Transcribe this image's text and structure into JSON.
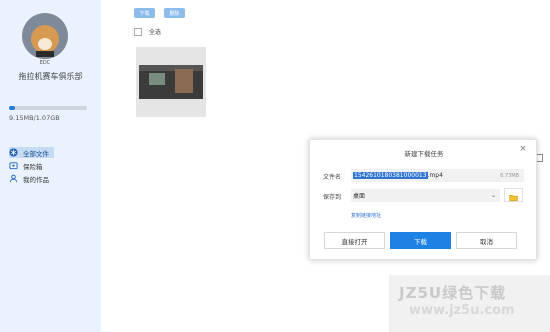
{
  "sidebar": {
    "avatar_tag": "EDC",
    "username": "拖拉机赛车俱乐部",
    "storage": {
      "text": "9.15MB/1.07GB",
      "fraction": 0.0083
    },
    "nav": [
      {
        "label": "全部文件",
        "icon": "snowflake-icon",
        "active": true
      },
      {
        "label": "保险箱",
        "icon": "safe-icon",
        "active": false
      },
      {
        "label": "我的作品",
        "icon": "person-icon",
        "active": false
      }
    ]
  },
  "toolbar": {
    "download_label": "下载",
    "delete_label": "删除"
  },
  "select_all_label": "全选",
  "dialog": {
    "title": "新建下载任务",
    "close_label": "×",
    "filename_label": "文件名",
    "filename_selected": "1542610180381000013",
    "filename_ext": ".mp4",
    "file_size": "8.73MB",
    "save_label": "保存到",
    "save_location": "桌面",
    "copy_link_label": "复制链接地址",
    "btn_open": "直接打开",
    "btn_download": "下载",
    "btn_cancel": "取消"
  },
  "watermark": {
    "brand": "JZ5U绿色下载",
    "url": "www.jz5u.com"
  },
  "colors": {
    "accent": "#1d82e3",
    "sidebar_bg": "#eaf3fd",
    "selection": "#2f74d0"
  }
}
